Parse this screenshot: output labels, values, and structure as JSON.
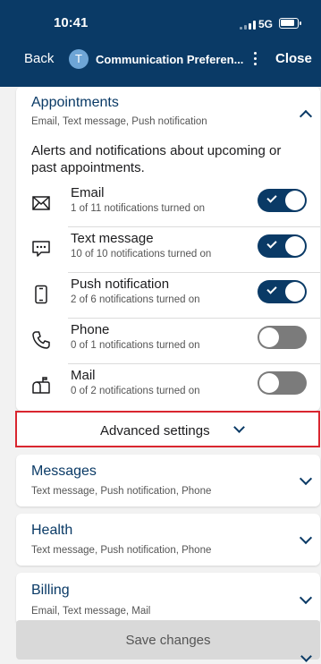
{
  "status_bar": {
    "time": "10:41",
    "network": "5G"
  },
  "nav": {
    "back": "Back",
    "avatar_initial": "T",
    "title": "Communication Preferen...",
    "close": "Close"
  },
  "appointments": {
    "title": "Appointments",
    "subtitle": "Email, Text message, Push notification",
    "description": "Alerts and notifications about upcoming or past appointments.",
    "channels": [
      {
        "name": "Email",
        "count": "1 of 11 notifications turned on",
        "on": true,
        "icon": "envelope-icon"
      },
      {
        "name": "Text message",
        "count": "10 of 10 notifications turned on",
        "on": true,
        "icon": "chat-bubble-icon"
      },
      {
        "name": "Push notification",
        "count": "2 of 6 notifications turned on",
        "on": true,
        "icon": "mobile-phone-icon"
      },
      {
        "name": "Phone",
        "count": "0 of 1 notifications turned on",
        "on": false,
        "icon": "phone-handset-icon"
      },
      {
        "name": "Mail",
        "count": "0 of 2 notifications turned on",
        "on": false,
        "icon": "mailbox-icon"
      }
    ],
    "advanced": "Advanced settings"
  },
  "sections": [
    {
      "title": "Messages",
      "subtitle": "Text message, Push notification, Phone"
    },
    {
      "title": "Health",
      "subtitle": "Text message, Push notification, Phone"
    },
    {
      "title": "Billing",
      "subtitle": "Email, Text message, Mail"
    }
  ],
  "save_button": "Save changes",
  "colors": {
    "brand": "#0a3a66",
    "toggle_off": "#7b7b7b",
    "highlight": "#d9262f"
  }
}
